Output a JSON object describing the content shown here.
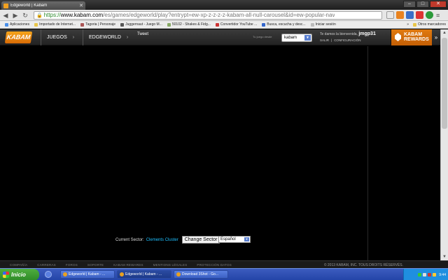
{
  "browser": {
    "tab_title": "Edgeworld | Kabam",
    "url_https": "https://",
    "url_domain": "www.kabam.com",
    "url_rest": "/es/games/edgeworld/play?entrypt=ew-xp-z-z-z-z-kabam-all-null-carousel&id=ew-popular-nav",
    "bookmarks": [
      "Aplicaciones",
      "Importado de Internet...",
      "Tagoria | Personaje",
      "Juggernaut - Juego M...",
      "50102 - Shakes & Fidg...",
      "Convertidor YouTube ...",
      "Busca, escucha y desc...",
      "Iniciar sesión"
    ],
    "bookmarks_more": "»",
    "other_bookmarks": "Otros marcadores"
  },
  "kabam": {
    "logo": "KABAM",
    "nav_juegos": "JUEGOS",
    "nav_edgeworld": "EDGEWORLD",
    "tweet": "Tweet",
    "tu_juego_label": "Tu juego desde",
    "select_value": "kabam",
    "welcome": "Te damos la bienvenida,",
    "username": "jmgp31",
    "salir": "SALIR",
    "configuracion": "CONFIGURACIÓN",
    "rewards_line1": "KABAM",
    "rewards_line2": "REWARDS",
    "collapse": "»"
  },
  "game": {
    "current_sector_label": "Current Sector:",
    "current_sector_value": "Clements Cluster",
    "change_sector": "Change Sector",
    "language": "Español"
  },
  "footer": {
    "links": [
      "COMPAÑÍA",
      "CARRERAS",
      "FOROS",
      "SOPORTE",
      "KABAM REWARDS",
      "MENTIONS LÉGALES",
      "PROTECCIÓN DATOS"
    ],
    "copyright": "© 2013 KABAM, INC. TOUS DROITS RÉSERVÉS."
  },
  "taskbar": {
    "start": "Inicio",
    "tasks": [
      "Edgeworld | Kabam - ...",
      "Edgeworld | Kabam - ...",
      "Download 3Shot - Go..."
    ],
    "clock": "9:44"
  }
}
